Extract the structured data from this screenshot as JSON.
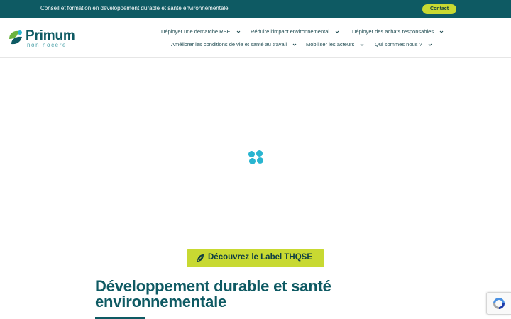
{
  "topbar": {
    "tagline": "Conseil et formation en développement durable et santé environnementale",
    "contact_label": "Contact"
  },
  "header": {
    "logo_name": "Primum",
    "logo_sub": "non nocere",
    "nav": [
      {
        "label": "Déployer une démarche RSE"
      },
      {
        "label": "Réduire l'impact environnemental"
      },
      {
        "label": "Déployer des achats responsables"
      },
      {
        "label": "Améliorer les conditions de vie et santé au travail"
      },
      {
        "label": "Mobiliser les acteurs"
      },
      {
        "label": "Qui sommes nous ?"
      }
    ]
  },
  "main": {
    "label_button": "Découvrez le Label THQSE",
    "title": "Développement durable et santé environnementale"
  },
  "colors": {
    "primary": "#0e5a63",
    "accent": "#c8d932",
    "loader": "#29b5d0"
  },
  "icons": {
    "loader": "loading-dots-icon",
    "leaf": "leaf-icon",
    "chevron": "chevron-down-icon",
    "recaptcha": "recaptcha-icon"
  }
}
